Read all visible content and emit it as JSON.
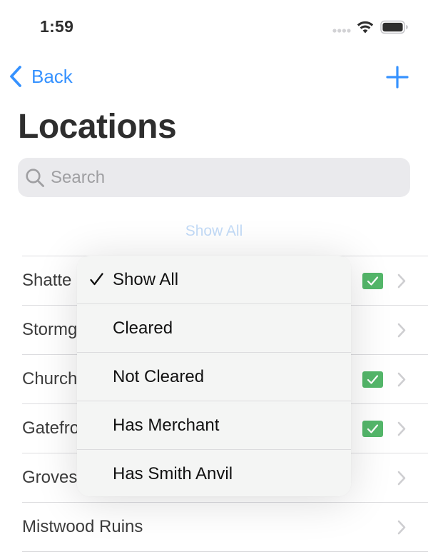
{
  "status_bar": {
    "time": "1:59"
  },
  "nav": {
    "back_label": "Back",
    "title": "Locations"
  },
  "search": {
    "placeholder": "Search",
    "value": ""
  },
  "filter": {
    "label": "Show All"
  },
  "locations": [
    {
      "name": "Shattered Plains",
      "visible_name": "Shatte",
      "checked": true
    },
    {
      "name": "Stormgate",
      "visible_name": "Stormg",
      "checked": false
    },
    {
      "name": "Church",
      "visible_name": "Church",
      "checked": true
    },
    {
      "name": "Gatefront",
      "visible_name": "Gatefro",
      "checked": true
    },
    {
      "name": "Groveside",
      "visible_name": "Groves",
      "checked": false
    },
    {
      "name": "Mistwood Ruins",
      "visible_name": "Mistwood Ruins",
      "checked": false
    }
  ],
  "menu": {
    "selected_index": 0,
    "items": [
      {
        "label": "Show All",
        "checked": true
      },
      {
        "label": "Cleared",
        "checked": false
      },
      {
        "label": "Not Cleared",
        "checked": false
      },
      {
        "label": "Has Merchant",
        "checked": false
      },
      {
        "label": "Has Smith Anvil",
        "checked": false
      }
    ]
  },
  "colors": {
    "accent": "#0a7aff",
    "filter_text": "#b6d3f6",
    "check_badge": "#2fa84a",
    "search_bg": "#e6e6e9"
  },
  "icons": {
    "back": "chevron-left-icon",
    "add": "plus-icon",
    "search": "magnifying-glass-icon",
    "row_disclosure": "chevron-right-icon",
    "checkbox": "checkmark-square-icon",
    "menu_check": "checkmark-icon"
  }
}
